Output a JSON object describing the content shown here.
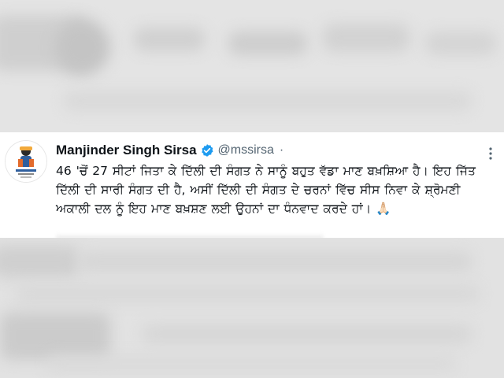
{
  "tweet": {
    "author_name": "Manjinder Singh Sirsa",
    "handle": "@mssirsa",
    "separator": "·",
    "text": "46 'ਚੋਂ 27 ਸੀਟਾਂ ਜਿਤਾ ਕੇ ਦਿੱਲੀ ਦੀ ਸੰਗਤ ਨੇ ਸਾਨੂੰ ਬਹੁਤ ਵੱਡਾ ਮਾਣ ਬਖ਼ਸ਼ਿਆ ਹੈ। ਇਹ ਜਿੱਤ ਦਿੱਲੀ ਦੀ ਸਾਰੀ ਸੰਗਤ ਦੀ ਹੈ, ਅਸੀਂ ਦਿੱਲੀ ਦੀ ਸੰਗਤ ਦੇ ਚਰਨਾਂ ਵਿੱਚ ਸੀਸ ਨਿਵਾ ਕੇ ਸ਼੍ਰੋਮਣੀ ਅਕਾਲੀ ਦਲ ਨੂੰ ਇਹ ਮਾਣ ਬਖ਼ਸ਼ਣ ਲਈ ਉਹਨਾਂ ਦਾ ਧੰਨਵਾਦ ਕਰਦੇ ਹਾਂ। 🙏🏻",
    "icons": {
      "verified": "verified-badge-icon",
      "more": "more-options-icon",
      "avatar": "profile-avatar"
    },
    "colors": {
      "verified": "#1d9bf0",
      "name": "#0f1419",
      "handle": "#536471"
    }
  }
}
